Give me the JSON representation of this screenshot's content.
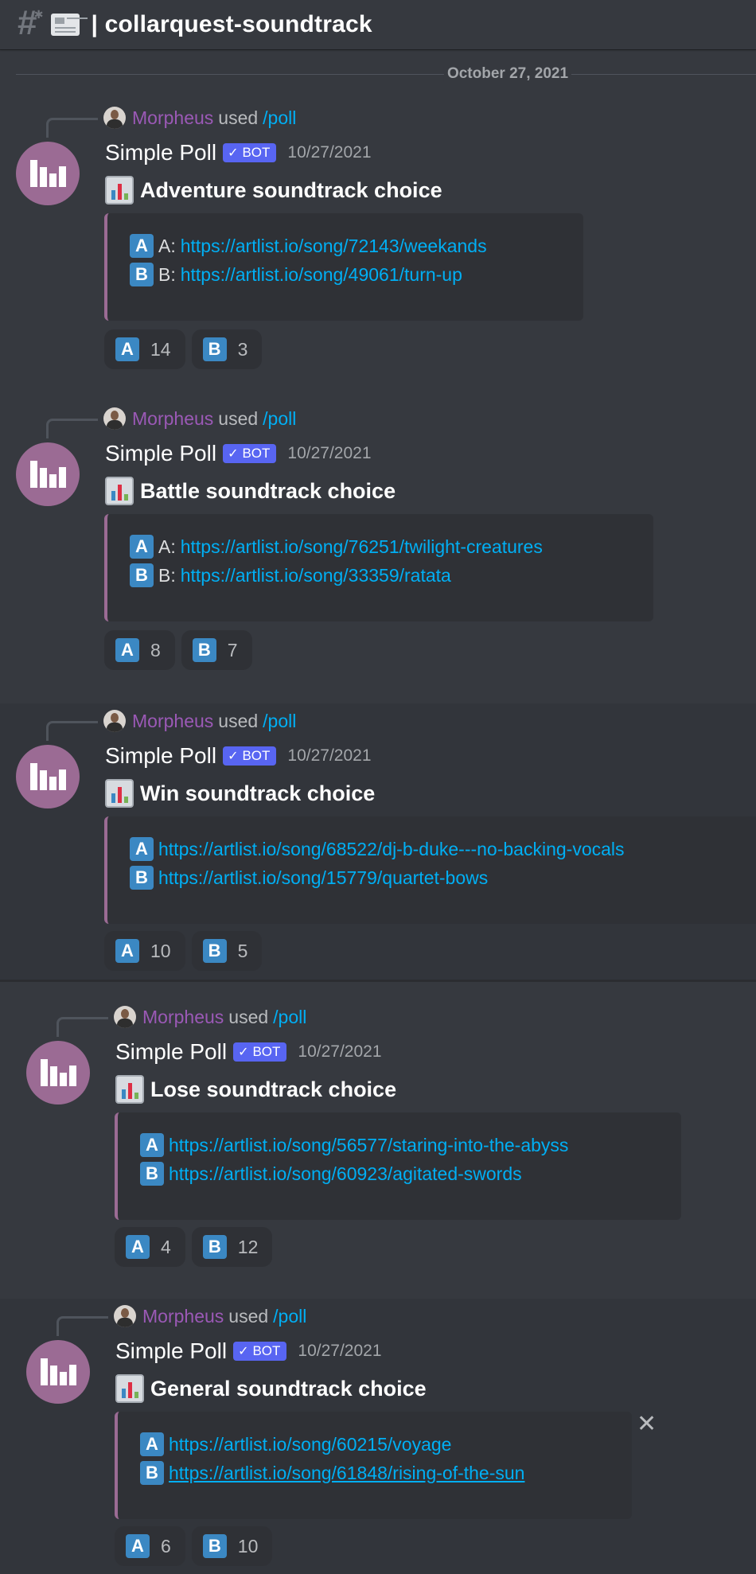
{
  "header": {
    "channel": "collarquest-soundtrack"
  },
  "date_divider": "October 27, 2021",
  "messages": [
    {
      "invoker": "Morpheus",
      "used": "used",
      "command": "/poll",
      "author": "Simple Poll",
      "bot": "BOT",
      "timestamp": "10/27/2021",
      "title": "Adventure soundtrack choice",
      "options": [
        {
          "emoji": "A",
          "prefix": "A:",
          "link": "https://artlist.io/song/72143/weekands"
        },
        {
          "emoji": "B",
          "prefix": "B:",
          "link": "https://artlist.io/song/49061/turn-up"
        }
      ],
      "reactions": [
        {
          "emoji": "A",
          "count": "14"
        },
        {
          "emoji": "B",
          "count": "3"
        }
      ]
    },
    {
      "invoker": "Morpheus",
      "used": "used",
      "command": "/poll",
      "author": "Simple Poll",
      "bot": "BOT",
      "timestamp": "10/27/2021",
      "title": "Battle soundtrack choice",
      "options": [
        {
          "emoji": "A",
          "prefix": "A:",
          "link": "https://artlist.io/song/76251/twilight-creatures"
        },
        {
          "emoji": "B",
          "prefix": "B:",
          "link": "https://artlist.io/song/33359/ratata"
        }
      ],
      "reactions": [
        {
          "emoji": "A",
          "count": "8"
        },
        {
          "emoji": "B",
          "count": "7"
        }
      ]
    },
    {
      "invoker": "Morpheus",
      "used": "used",
      "command": "/poll",
      "author": "Simple Poll",
      "bot": "BOT",
      "timestamp": "10/27/2021",
      "title": "Win soundtrack choice",
      "options": [
        {
          "emoji": "A",
          "prefix": "",
          "link": "https://artlist.io/song/68522/dj-b-duke---no-backing-vocals"
        },
        {
          "emoji": "B",
          "prefix": "",
          "link": "https://artlist.io/song/15779/quartet-bows"
        }
      ],
      "reactions": [
        {
          "emoji": "A",
          "count": "10"
        },
        {
          "emoji": "B",
          "count": "5"
        }
      ]
    },
    {
      "invoker": "Morpheus",
      "used": "used",
      "command": "/poll",
      "author": "Simple Poll",
      "bot": "BOT",
      "timestamp": "10/27/2021",
      "title": "Lose soundtrack choice",
      "options": [
        {
          "emoji": "A",
          "prefix": "",
          "link": "https://artlist.io/song/56577/staring-into-the-abyss"
        },
        {
          "emoji": "B",
          "prefix": "",
          "link": "https://artlist.io/song/60923/agitated-swords"
        }
      ],
      "reactions": [
        {
          "emoji": "A",
          "count": "4"
        },
        {
          "emoji": "B",
          "count": "12"
        }
      ]
    },
    {
      "invoker": "Morpheus",
      "used": "used",
      "command": "/poll",
      "author": "Simple Poll",
      "bot": "BOT",
      "timestamp": "10/27/2021",
      "title": "General soundtrack choice",
      "options": [
        {
          "emoji": "A",
          "prefix": "",
          "link": "https://artlist.io/song/60215/voyage"
        },
        {
          "emoji": "B",
          "prefix": "",
          "link": "https://artlist.io/song/61848/rising-of-the-sun"
        }
      ],
      "reactions": [
        {
          "emoji": "A",
          "count": "6"
        },
        {
          "emoji": "B",
          "count": "10"
        }
      ]
    }
  ]
}
